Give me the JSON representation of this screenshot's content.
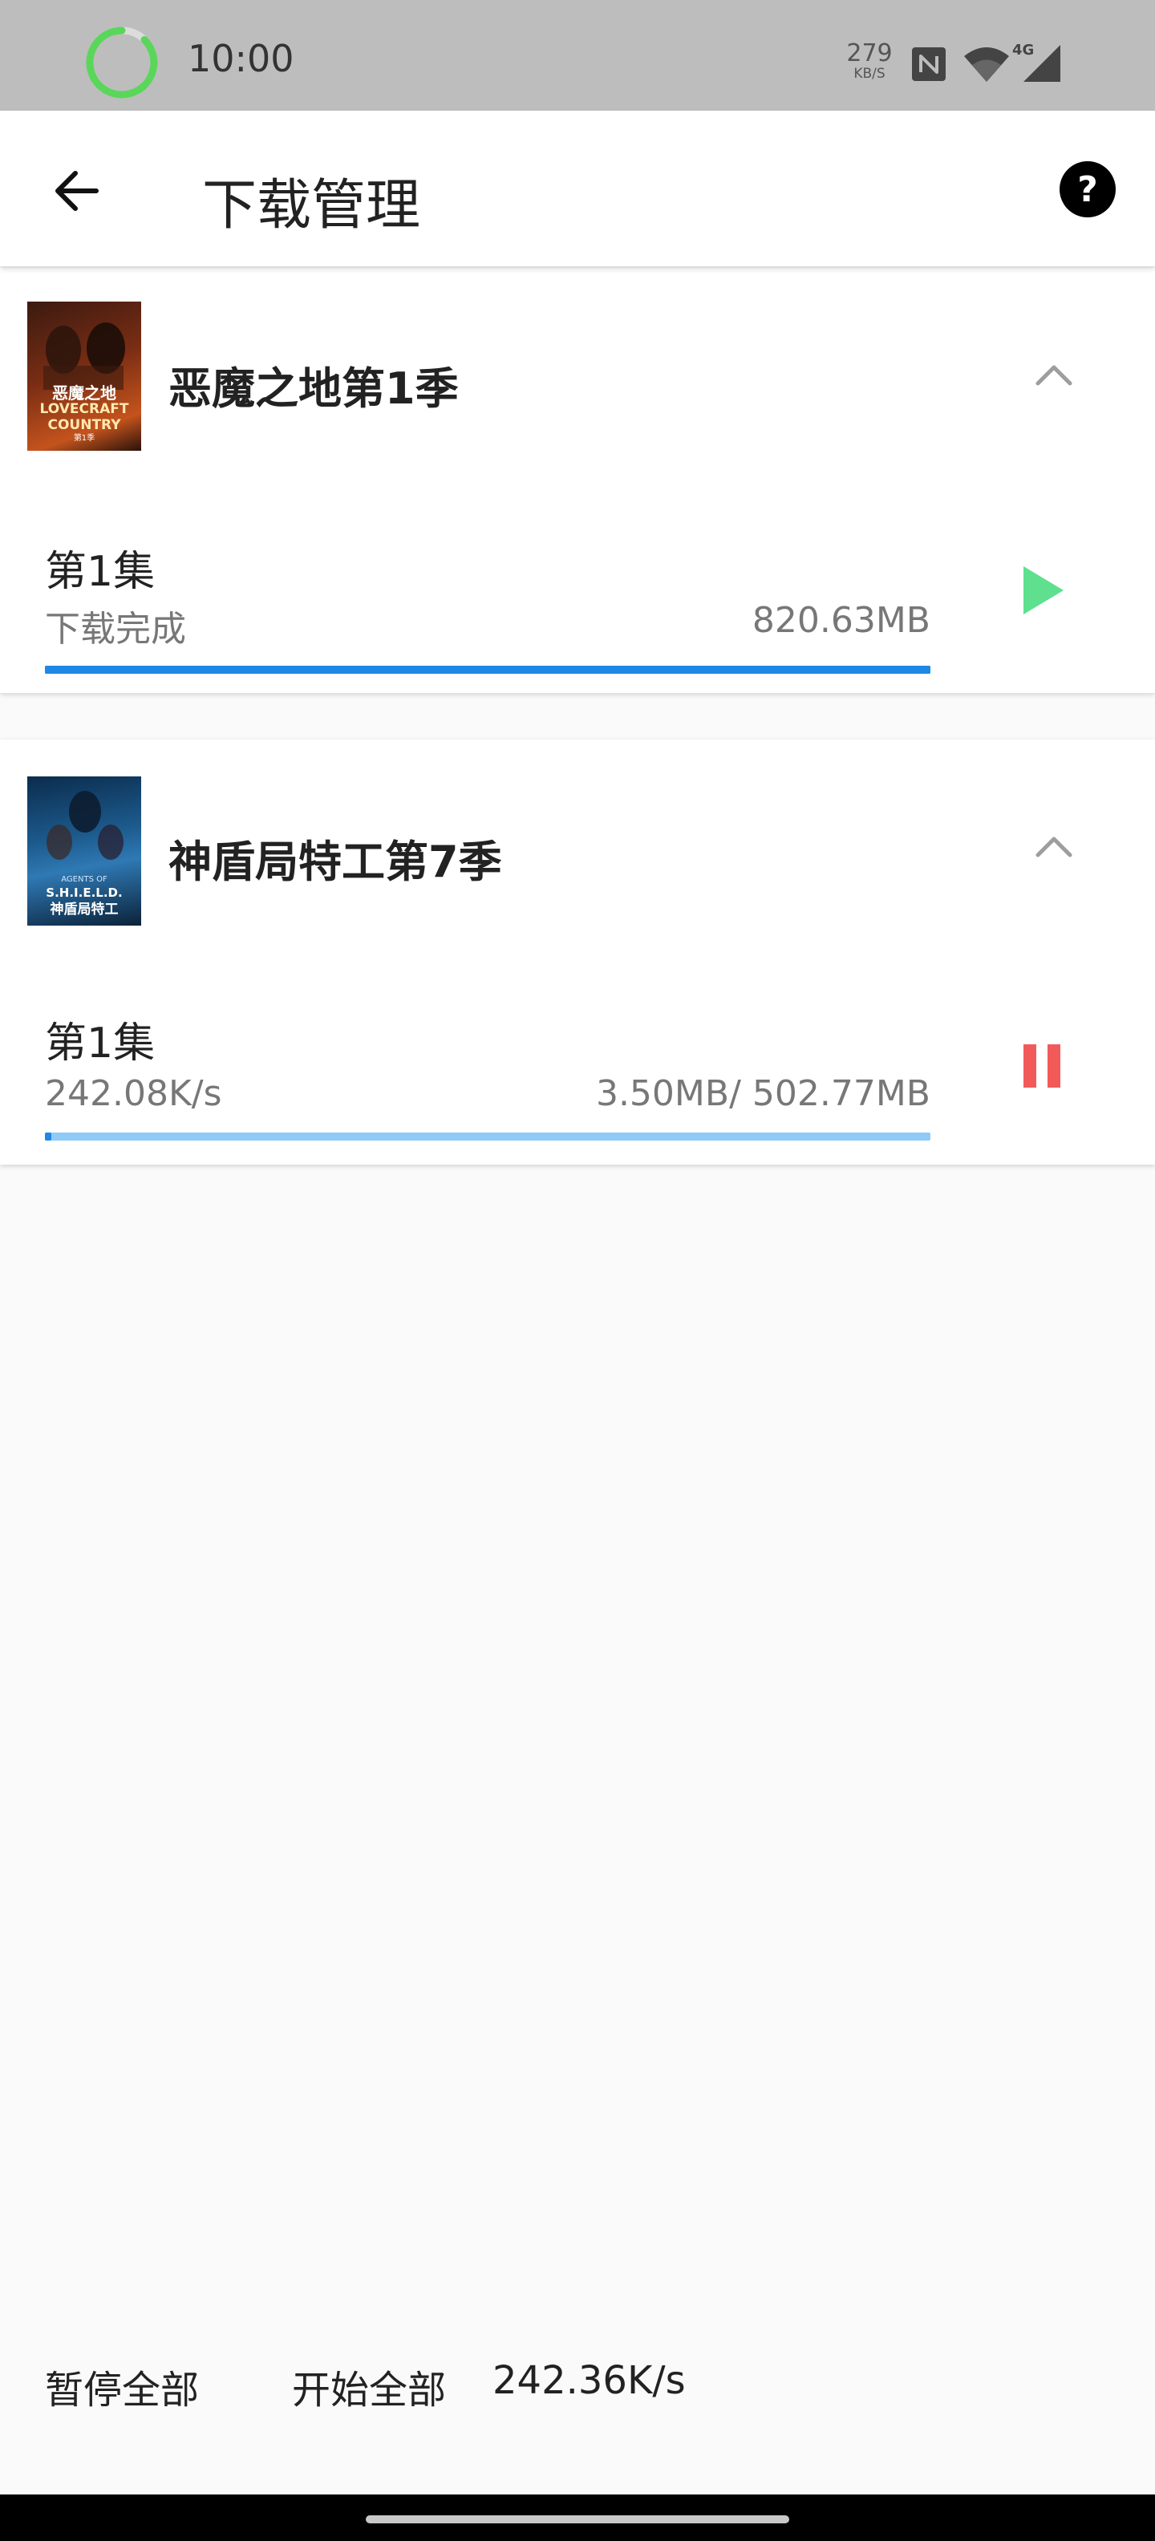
{
  "status_bar": {
    "time": "10:00",
    "net_speed_value": "279",
    "net_speed_unit": "KB/S",
    "network_label": "4G"
  },
  "app_bar": {
    "title": "下载管理"
  },
  "downloads": [
    {
      "show_title": "恶魔之地第1季",
      "poster": {
        "line1": "恶魔之地",
        "line2": "LOVECRAFT",
        "line3": "COUNTRY",
        "line4": "第1季"
      },
      "episode": "第1集",
      "status_left": "下载完成",
      "status_right": "820.63MB",
      "progress_percent": 100,
      "progress_color": "#1e88e5",
      "track_color": "#1e88e5",
      "action": "play-icon",
      "action_color": "#5ee08e"
    },
    {
      "show_title": "神盾局特工第7季",
      "poster": {
        "line1": "AGENTS OF",
        "line2": "S.H.I.E.L.D.",
        "line3": "神盾局特工"
      },
      "episode": "第1集",
      "status_left": "242.08K/s",
      "status_right": "3.50MB/ 502.77MB",
      "progress_percent": 0.7,
      "progress_color": "#1e88e5",
      "track_color": "#90caf9",
      "action": "pause-icon",
      "action_color": "#f25a5a"
    }
  ],
  "bottom_bar": {
    "pause_all": "暂停全部",
    "start_all": "开始全部",
    "total_speed": "242.36K/s"
  },
  "colors": {
    "status_bar_bg": "#bdbdbd",
    "ring_green": "#5ad65a",
    "page_bg": "#fafafa"
  }
}
